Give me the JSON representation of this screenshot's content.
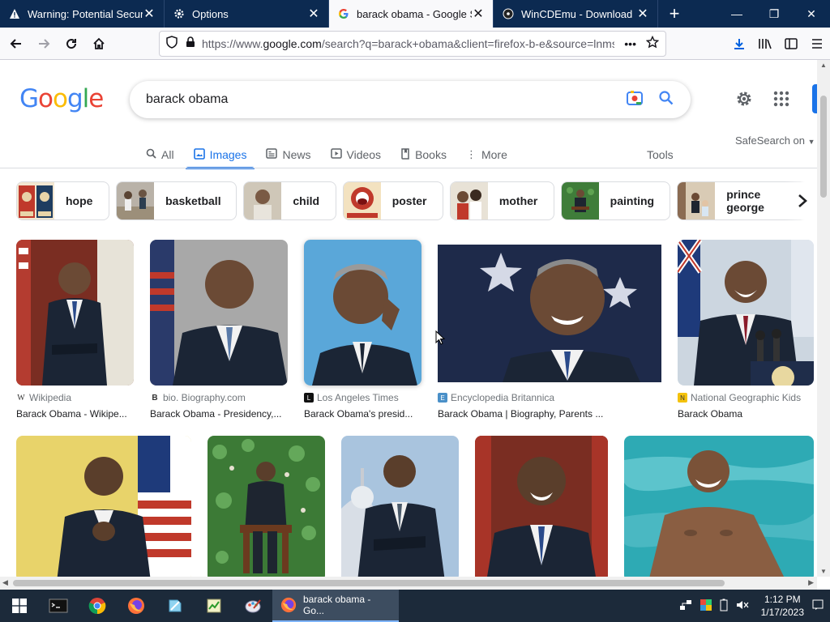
{
  "browser": {
    "tabs": [
      {
        "label": "Warning: Potential Security Risk",
        "icon": "warning-icon",
        "active": false
      },
      {
        "label": "Options",
        "icon": "gear-icon",
        "active": false
      },
      {
        "label": "barack obama - Google Search",
        "icon": "google-g-icon",
        "active": true
      },
      {
        "label": "WinCDEmu - Download",
        "icon": "wincdemu-icon",
        "active": false
      }
    ],
    "url_prefix": "https://www.",
    "url_domain": "google.com",
    "url_rest": "/search?q=barack+obama&client=firefox-b-e&source=lnms",
    "more": "•••"
  },
  "google": {
    "logo_letters": [
      "G",
      "o",
      "o",
      "g",
      "l",
      "e"
    ],
    "logo_colors": [
      "#4285f4",
      "#ea4335",
      "#fbbc05",
      "#4285f4",
      "#34a853",
      "#ea4335"
    ],
    "query": "barack obama",
    "tabs": [
      {
        "label": "All",
        "icon": "🔍"
      },
      {
        "label": "Images",
        "icon": "▣"
      },
      {
        "label": "News",
        "icon": "▤"
      },
      {
        "label": "Videos",
        "icon": "▶"
      },
      {
        "label": "Books",
        "icon": "▮"
      },
      {
        "label": "More",
        "icon": "⋮"
      }
    ],
    "tools": "Tools",
    "safesearch": "SafeSearch on",
    "chips": [
      "hope",
      "basketball",
      "child",
      "poster",
      "mother",
      "painting",
      "prince george"
    ],
    "results_row1": [
      {
        "source": "Wikipedia",
        "fav": "W",
        "title": "Barack Obama - Wikipe..."
      },
      {
        "source": "bio. Biography.com",
        "fav": "B",
        "title": "Barack Obama - Presidency,..."
      },
      {
        "source": "Los Angeles Times",
        "fav": "L",
        "title": "Barack Obama's presid..."
      },
      {
        "source": "Encyclopedia Britannica",
        "fav": "E",
        "title": "Barack Obama | Biography, Parents ..."
      },
      {
        "source": "National Geographic Kids",
        "fav": "N",
        "title": "Barack Obama"
      }
    ]
  },
  "taskbar": {
    "active_label": "barack obama - Go...",
    "time": "1:12 PM",
    "date": "1/17/2023"
  }
}
